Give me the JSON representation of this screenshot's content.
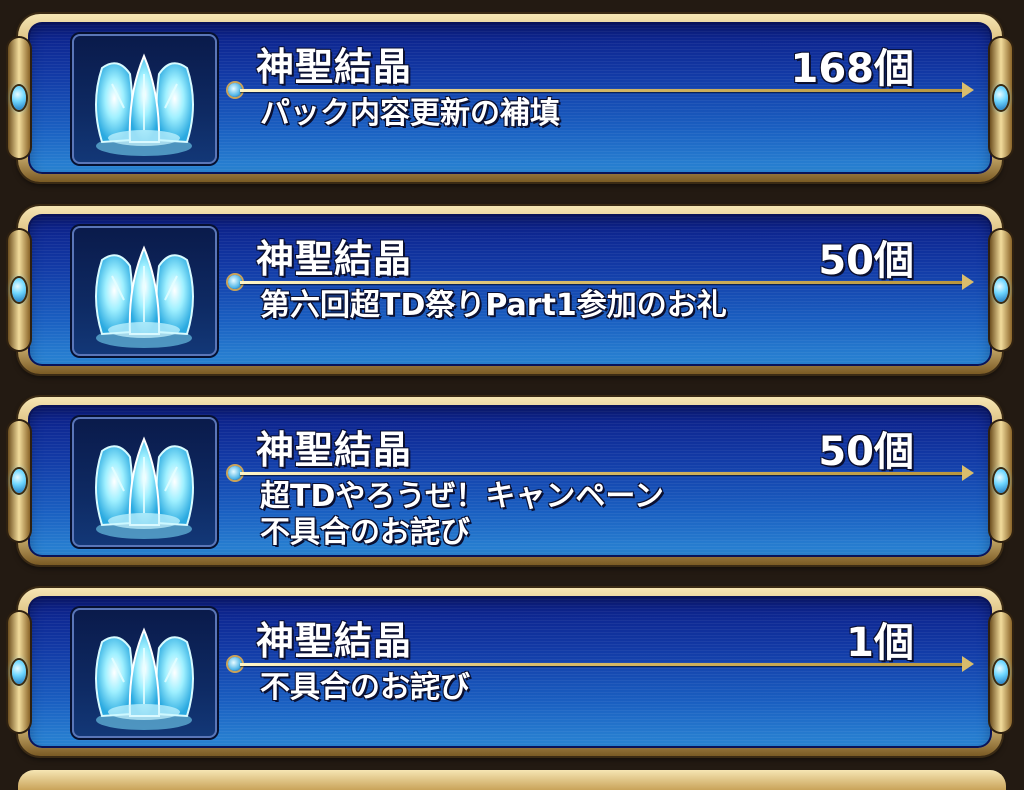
{
  "rewards": [
    {
      "icon": "divine-crystal-icon",
      "item_name": "神聖結晶",
      "quantity": "168個",
      "description_lines": [
        "パック内容更新の補填"
      ]
    },
    {
      "icon": "divine-crystal-icon",
      "item_name": "神聖結晶",
      "quantity": "50個",
      "description_lines": [
        "第六回超TD祭りPart1参加のお礼"
      ]
    },
    {
      "icon": "divine-crystal-icon",
      "item_name": "神聖結晶",
      "quantity": "50個",
      "description_lines": [
        "超TDやろうぜ！キャンペーン",
        "不具合のお詫び"
      ]
    },
    {
      "icon": "divine-crystal-icon",
      "item_name": "神聖結晶",
      "quantity": "1個",
      "description_lines": [
        "不具合のお詫び"
      ]
    }
  ],
  "colors": {
    "panel_blue": "#123aa6",
    "frame_gold": "#c9a35a",
    "crystal_cyan": "#7fe3ff"
  }
}
